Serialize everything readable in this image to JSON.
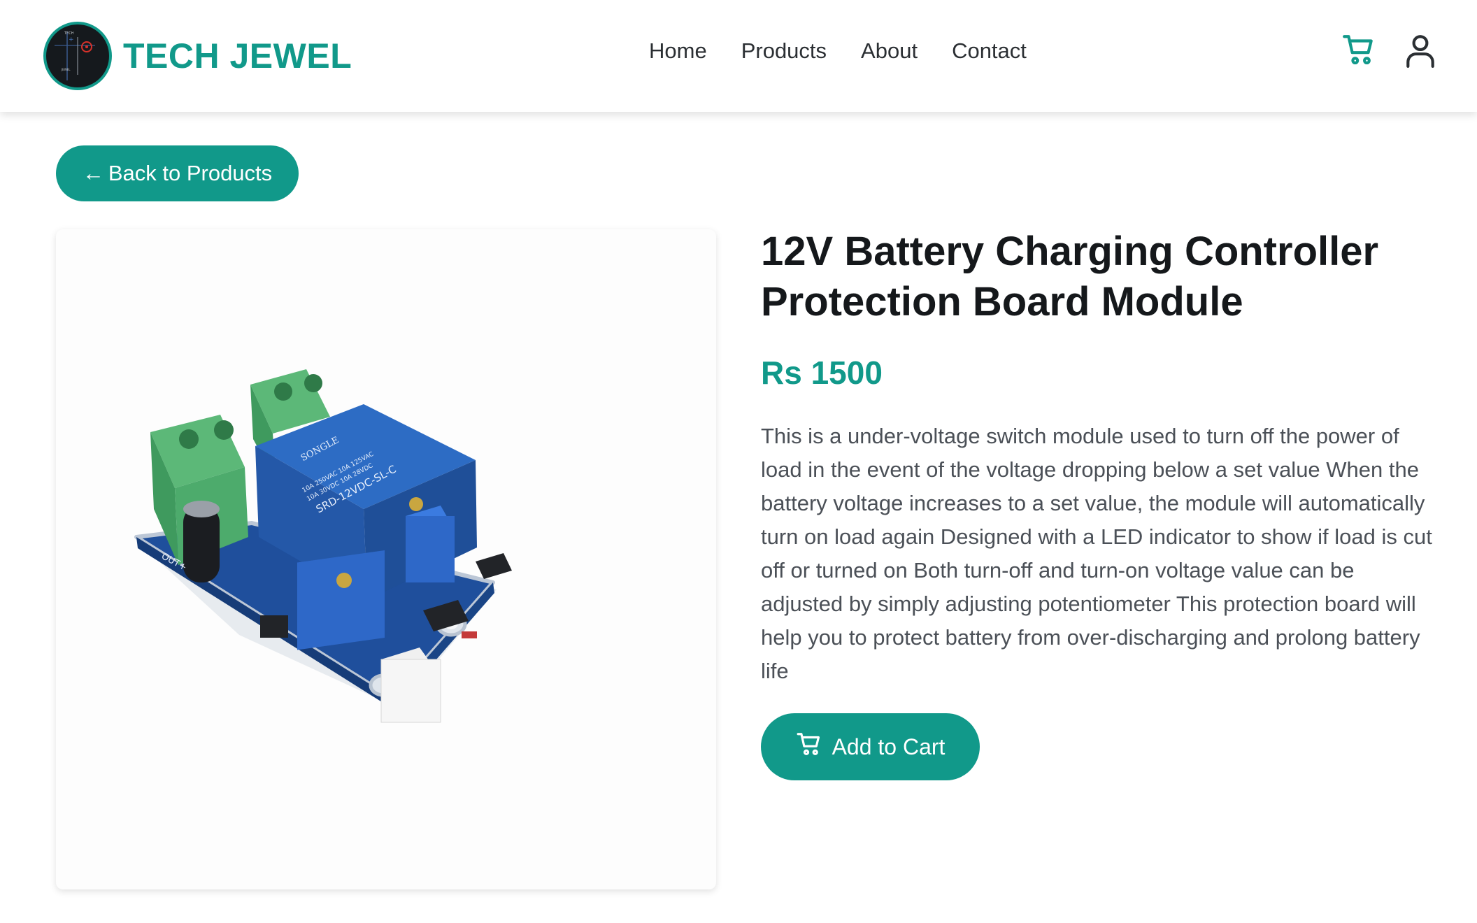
{
  "brand": {
    "name": "TECH JEWEL",
    "logo_text_top": "TECH",
    "logo_text_bottom": "JEWEL",
    "accent_color": "#11998a"
  },
  "nav": {
    "items": [
      {
        "label": "Home"
      },
      {
        "label": "Products"
      },
      {
        "label": "About"
      },
      {
        "label": "Contact"
      }
    ]
  },
  "header_icons": [
    "cart-icon",
    "user-icon"
  ],
  "back_button": {
    "arrow": "←",
    "label": "Back to Products"
  },
  "product": {
    "title": "12V Battery Charging Controller Protection Board Module",
    "price": "Rs 1500",
    "description": "This is a under-voltage switch module used to turn off the power of load in the event of the voltage dropping below a set value When the battery voltage increases to a set value, the module will automatically turn on load again Designed with a LED indicator to show if load is cut off or turned on Both turn-off and turn-on voltage value can be adjusted by simply adjusting potentiometer This protection board will help you to protect battery from over-discharging and prolong battery life",
    "image_labels": {
      "relay_brand": "SONGLE",
      "relay_model": "SRD-12VDC-SL-C",
      "relay_rating_1": "10A 250VAC 10A 125VAC",
      "relay_rating_2": "10A 30VDC 10A 28VDC",
      "out_label": "OUT+"
    },
    "add_to_cart_label": "Add to Cart"
  }
}
